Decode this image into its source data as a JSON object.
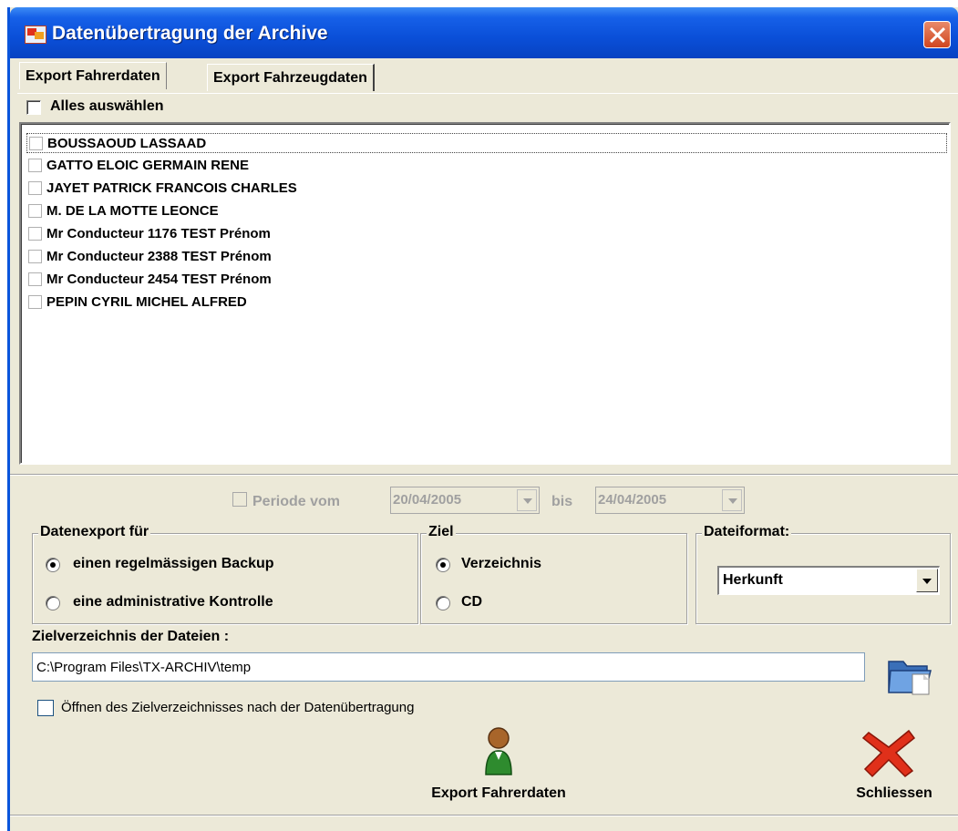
{
  "window": {
    "title": "Datenübertragung der Archive"
  },
  "tabs": [
    {
      "label": "Export Fahrerdaten",
      "active": true
    },
    {
      "label": "Export Fahrzeugdaten",
      "active": false
    }
  ],
  "select_all": {
    "label": "Alles auswählen",
    "checked": false
  },
  "drivers": [
    "BOUSSAOUD LASSAAD",
    "GATTO ELOIC GERMAIN RENE",
    "JAYET PATRICK FRANCOIS CHARLES",
    "M. DE LA MOTTE LEONCE",
    "Mr Conducteur 1176 TEST Prénom",
    "Mr Conducteur 2388 TEST Prénom",
    "Mr Conducteur 2454 TEST Prénom",
    "PEPIN CYRIL MICHEL ALFRED"
  ],
  "period": {
    "label": "Periode vom",
    "from": "20/04/2005",
    "bis_label": "bis",
    "to": "24/04/2005",
    "enabled": false
  },
  "export_for": {
    "legend": "Datenexport für",
    "options": [
      "einen regelmässigen Backup",
      "eine administrative Kontrolle"
    ],
    "selected": "einen regelmässigen Backup"
  },
  "ziel": {
    "legend": "Ziel",
    "options": [
      "Verzeichnis",
      "CD"
    ],
    "selected": "Verzeichnis"
  },
  "format": {
    "legend": "Dateiformat:",
    "value": "Herkunft"
  },
  "target_dir": {
    "label": "Zielverzeichnis der Dateien :",
    "value": "C:\\Program Files\\TX-ARCHIV\\temp",
    "open_after_label": "Öffnen des Zielverzeichnisses nach der Datenübertragung"
  },
  "actions": {
    "export_label": "Export Fahrerdaten",
    "close_label": "Schliessen"
  },
  "colors": {
    "titlebar": "#0a4fd8",
    "face": "#ece9d8",
    "close_red": "#e0301a",
    "person_green": "#2e8b2e"
  }
}
